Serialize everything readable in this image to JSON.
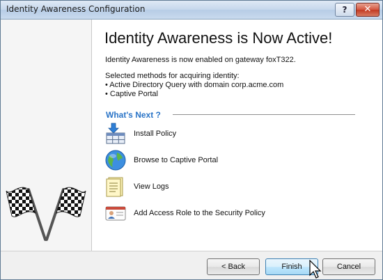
{
  "window": {
    "title": "Identity Awareness Configuration",
    "help_label": "?",
    "close_label": "✕"
  },
  "main": {
    "heading": "Identity Awareness is Now Active!",
    "status_line": "Identity Awareness is now enabled on gateway foxT322.",
    "methods_intro": "Selected methods for acquiring identity:",
    "methods": [
      "• Active Directory Query with domain corp.acme.com",
      "• Captive Portal"
    ],
    "whats_next_label": "What's Next ?",
    "actions": [
      {
        "label": "Install Policy",
        "icon": "install-policy-icon"
      },
      {
        "label": "Browse to Captive Portal",
        "icon": "globe-icon"
      },
      {
        "label": "View Logs",
        "icon": "logs-icon"
      },
      {
        "label": "Add Access Role to the Security Policy",
        "icon": "access-role-icon"
      }
    ]
  },
  "footer": {
    "back_label": "< Back",
    "finish_label": "Finish",
    "cancel_label": "Cancel"
  },
  "colors": {
    "accent": "#2a74c7",
    "titlebar": "#c7d8ec",
    "close": "#c23a22"
  }
}
